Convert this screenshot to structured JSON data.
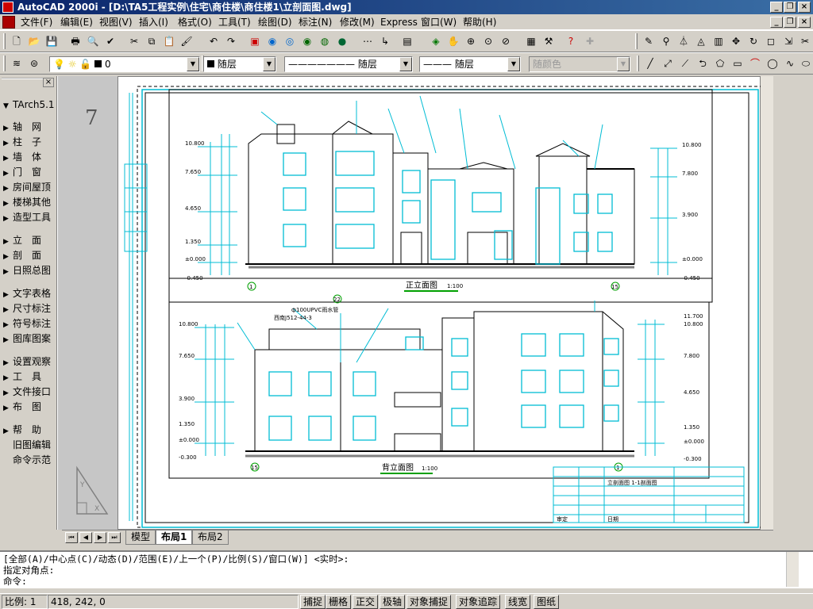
{
  "window": {
    "title": "AutoCAD 2000i - [D:\\TA5工程实例\\住宅\\商住楼\\商住楼1\\立剖面图.dwg]"
  },
  "menu": {
    "items": [
      "文件(F)",
      "编辑(E)",
      "视图(V)",
      "插入(I)",
      "格式(O)",
      "工具(T)",
      "绘图(D)",
      "标注(N)",
      "修改(M)",
      "Express",
      "窗口(W)",
      "帮助(H)"
    ]
  },
  "toolbar": {
    "layer_value": "0",
    "color_value": "随层",
    "linetype_value": "随层",
    "lineweight_value": "随层",
    "plotstyle_value": "随颜色"
  },
  "tarch": {
    "title": "TArch5.1",
    "group1": [
      "轴　网",
      "柱　子",
      "墙　体",
      "门　窗",
      "房间屋顶",
      "楼梯其他",
      "造型工具"
    ],
    "group2": [
      "立　面",
      "剖　面",
      "日照总图"
    ],
    "group3": [
      "文字表格",
      "尺寸标注",
      "符号标注",
      "图库图案"
    ],
    "group4": [
      "设置观察",
      "工　具",
      "文件接口",
      "布　图"
    ],
    "group5": [
      "帮　助"
    ],
    "group5_plain": [
      "旧图编辑",
      "命令示范"
    ]
  },
  "drawing": {
    "margin_number": "7",
    "front_title": "正立面图",
    "front_scale": "1:100",
    "back_title": "背立面图",
    "back_scale": "1:100",
    "axis_front_left": "1",
    "axis_front_right": "15",
    "axis_back_left": "15",
    "axis_back_right": "1",
    "axis_marker": "22",
    "level_labels": [
      "10.800",
      "7.650",
      "4.650",
      "1.350",
      "±0.000",
      "-0.450"
    ],
    "level_labels_back": [
      "10.800",
      "7.650",
      "3.900",
      "1.350",
      "±0.000",
      "-0.300"
    ],
    "right_levels": [
      "10.800",
      "7.800",
      "3.900",
      "±0.000",
      "-0.450"
    ],
    "right_levels_back": [
      "11.700",
      "10.800",
      "7.800",
      "4.650",
      "1.350",
      "±0.000",
      "-0.300"
    ],
    "note_back_pipe": "ф100UPVC雨水管",
    "note_back_ref": "西南J512-44-3",
    "titleblock_name": "立剖面图 1-1剖面图",
    "titleblock_date": "日期",
    "titleblock_review": "审定"
  },
  "tabs": [
    "模型",
    "布局1",
    "布局2"
  ],
  "active_tab": "布局1",
  "command": {
    "line1": "[全部(A)/中心点(C)/动态(D)/范围(E)/上一个(P)/比例(S)/窗口(W)] <实时>:",
    "line2": "指定对角点:",
    "line3": "命令:"
  },
  "status": {
    "scale_label": "比例: 1",
    "coords": "418, 242, 0",
    "toggles": [
      "捕捉",
      "栅格",
      "正交",
      "极轴",
      "对象捕捉",
      "对象追踪",
      "线宽",
      "图纸"
    ]
  }
}
